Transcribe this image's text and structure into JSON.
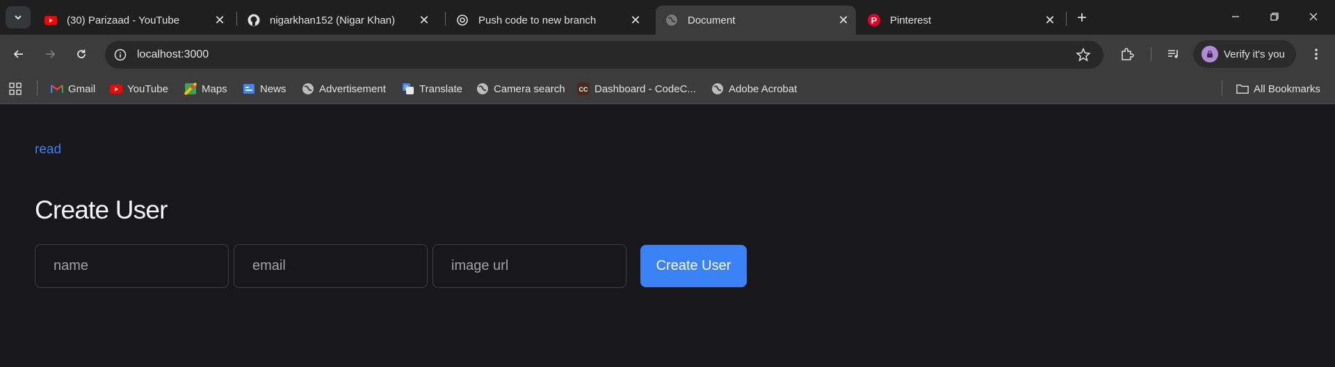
{
  "tabs": [
    {
      "title": "(30) Parizaad - YouTube",
      "icon": "youtube-icon"
    },
    {
      "title": "nigarkhan152 (Nigar Khan)",
      "icon": "github-icon"
    },
    {
      "title": "Push code to new branch",
      "icon": "chatgpt-icon"
    },
    {
      "title": "Document",
      "icon": "globe-icon",
      "active": true
    },
    {
      "title": "Pinterest",
      "icon": "pinterest-icon"
    }
  ],
  "toolbar": {
    "url": "localhost:3000",
    "profile_label": "Verify it's you"
  },
  "bookmarks": {
    "items": [
      {
        "label": "Gmail",
        "icon": "gmail-icon"
      },
      {
        "label": "YouTube",
        "icon": "youtube-icon"
      },
      {
        "label": "Maps",
        "icon": "maps-icon"
      },
      {
        "label": "News",
        "icon": "news-icon"
      },
      {
        "label": "Advertisement",
        "icon": "globe-icon"
      },
      {
        "label": "Translate",
        "icon": "translate-icon"
      },
      {
        "label": "Camera search",
        "icon": "globe-icon"
      },
      {
        "label": "Dashboard - CodeC...",
        "icon": "codecademy-icon"
      },
      {
        "label": "Adobe Acrobat",
        "icon": "globe-icon"
      }
    ],
    "all_label": "All Bookmarks"
  },
  "page": {
    "read_link": "read",
    "heading": "Create User",
    "name_placeholder": "name",
    "email_placeholder": "email",
    "image_placeholder": "image url",
    "submit_label": "Create User"
  },
  "colors": {
    "accent": "#3b82f6",
    "page_bg": "#18181b"
  }
}
